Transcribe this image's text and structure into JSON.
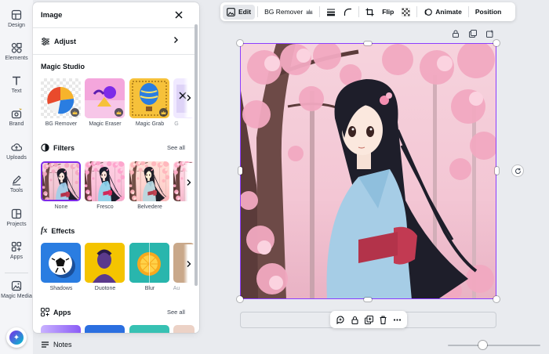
{
  "rail": {
    "items": [
      {
        "label": "Design",
        "icon": "layout-icon"
      },
      {
        "label": "Elements",
        "icon": "shapes-icon"
      },
      {
        "label": "Text",
        "icon": "text-icon"
      },
      {
        "label": "Brand",
        "icon": "brand-icon"
      },
      {
        "label": "Uploads",
        "icon": "cloud-upload-icon"
      },
      {
        "label": "Tools",
        "icon": "pen-icon"
      },
      {
        "label": "Projects",
        "icon": "folder-icon"
      },
      {
        "label": "Apps",
        "icon": "apps-icon"
      },
      {
        "label": "Magic Media",
        "icon": "magic-media-icon"
      }
    ]
  },
  "panel": {
    "title": "Image",
    "adjust_label": "Adjust",
    "magic_studio": {
      "title": "Magic Studio",
      "items": [
        {
          "label": "BG Remover"
        },
        {
          "label": "Magic Eraser"
        },
        {
          "label": "Magic Grab"
        },
        {
          "label": "G"
        }
      ]
    },
    "filters": {
      "title": "Filters",
      "see_all": "See all",
      "items": [
        {
          "label": "None"
        },
        {
          "label": "Fresco"
        },
        {
          "label": "Belvedere"
        }
      ]
    },
    "effects": {
      "title": "Effects",
      "items": [
        {
          "label": "Shadows"
        },
        {
          "label": "Duotone"
        },
        {
          "label": "Blur"
        },
        {
          "label": "Au"
        }
      ]
    },
    "apps": {
      "title": "Apps",
      "see_all": "See all"
    }
  },
  "notes_label": "Notes",
  "toolbar": {
    "edit": "Edit",
    "bg_remover": "BG Remover",
    "flip": "Flip",
    "animate": "Animate",
    "position": "Position"
  },
  "colors": {
    "accent": "#8b3dff",
    "selected_filter_border": "#7d2ae8"
  },
  "zoom": {
    "level": 0.38
  }
}
